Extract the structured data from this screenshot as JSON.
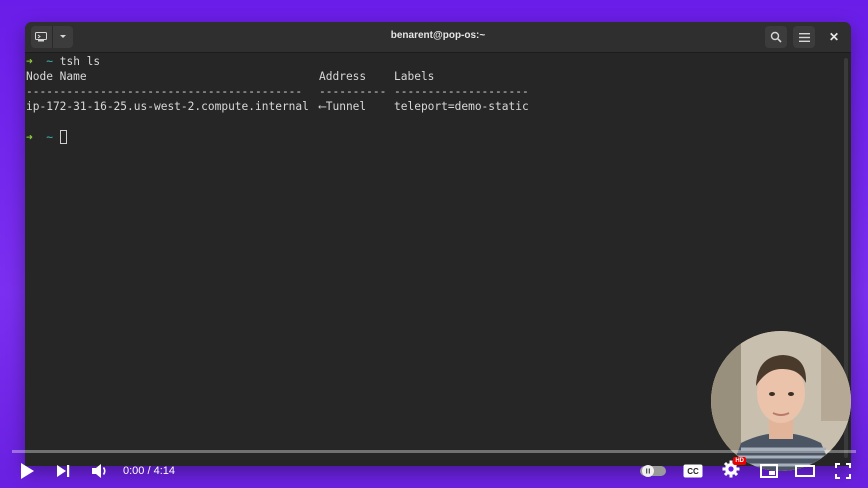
{
  "window": {
    "title": "benarent@pop-os:~"
  },
  "terminal": {
    "prompt_arrow": "➜",
    "prompt_dir": "~",
    "command": "tsh ls",
    "table": {
      "headers": [
        "Node Name",
        "Address",
        "Labels"
      ],
      "separators": [
        "-----------------------------------------",
        "----------",
        "--------------------"
      ],
      "rows": [
        [
          "ip-172-31-16-25.us-west-2.compute.internal",
          "⟵Tunnel",
          "teleport=demo-static"
        ]
      ]
    }
  },
  "player": {
    "time": "0:00 / 4:14",
    "hd_badge": "HD",
    "progress": 0
  },
  "colors": {
    "background": "#6a1de8",
    "terminal_bg": "#262626",
    "prompt_arrow": "#8ccf3b",
    "prompt_dir": "#3fb6b9"
  },
  "icons": [
    "terminal-icon",
    "chevron-down-icon",
    "search-icon",
    "menu-icon",
    "close-icon",
    "play-icon",
    "skip-next-icon",
    "volume-icon",
    "autoplay-toggle-icon",
    "captions-icon",
    "settings-icon",
    "miniplayer-icon",
    "theater-icon",
    "fullscreen-icon"
  ]
}
